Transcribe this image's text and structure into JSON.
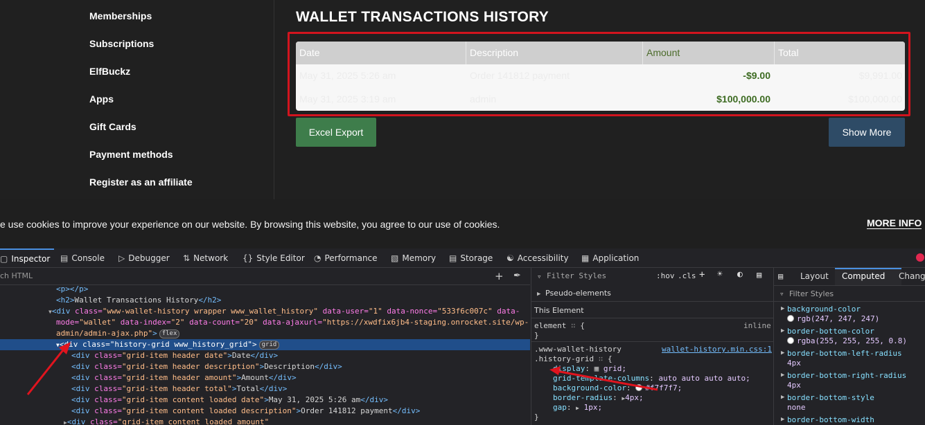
{
  "sidebar": {
    "items": [
      {
        "label": "Memberships"
      },
      {
        "label": "Subscriptions"
      },
      {
        "label": "ElfBuckz"
      },
      {
        "label": "Apps"
      },
      {
        "label": "Gift Cards"
      },
      {
        "label": "Payment methods"
      },
      {
        "label": "Register as an affiliate"
      }
    ]
  },
  "main": {
    "title": "WALLET TRANSACTIONS HISTORY",
    "table": {
      "columns": [
        "Date",
        "Description",
        "Amount",
        "Total"
      ],
      "rows": [
        {
          "date": "May 31, 2025 5:26 am",
          "description": "Order 141812 payment",
          "amount": "-$9.00",
          "total": "$9,991.00"
        },
        {
          "date": "May 31, 2025 3:19 am",
          "description": "admin",
          "amount": "$100,000.00",
          "total": "$100,000.00"
        }
      ]
    },
    "excel_label": "Excel Export",
    "show_more_label": "Show More",
    "highlight_color": "#d2141e"
  },
  "cookie": {
    "text": "e use cookies to improve your experience on our website. By browsing this website, you agree to our use of cookies.",
    "more_info": "MORE INFO"
  },
  "devtools": {
    "tabs": [
      {
        "label": "Inspector",
        "icon": "inspector-icon"
      },
      {
        "label": "Console",
        "icon": "console-icon"
      },
      {
        "label": "Debugger",
        "icon": "debugger-icon"
      },
      {
        "label": "Network",
        "icon": "network-icon"
      },
      {
        "label": "Style Editor",
        "icon": "style-editor-icon"
      },
      {
        "label": "Performance",
        "icon": "performance-icon"
      },
      {
        "label": "Memory",
        "icon": "memory-icon"
      },
      {
        "label": "Storage",
        "icon": "storage-icon"
      },
      {
        "label": "Accessibility",
        "icon": "accessibility-icon"
      },
      {
        "label": "Application",
        "icon": "application-icon"
      }
    ],
    "search_placeholder": "ch HTML",
    "html_lines": {
      "l1": "<p></p>",
      "l2_tag": "<h2>",
      "l2_text": "Wallet Transactions History",
      "l2_end": "</h2>",
      "l3a": "<div ",
      "l3_attr1": "class=",
      "l3_val1": "\"www-wallet-history wrapper www_wallet_history\"",
      "l3_attr2": " data-user=",
      "l3_val2": "\"1\"",
      "l3_attr3": " data-nonce=",
      "l3_val3": "\"533f6c007c\"",
      "l3_attr4": " data-",
      "l4_attr": "mode=",
      "l4_val": "\"wallet\"",
      "l4_attr2": " data-index=",
      "l4_val2": "\"2\"",
      "l4_attr3": " data-count=",
      "l4_val3": "\"20\"",
      "l4_attr4": " data-ajaxurl=",
      "l4_val4": "\"https://xwdfix6jb4-staging.onrocket.site/wp-",
      "l5_val": "admin/admin-ajax.php\"",
      "l5_end": ">",
      "flex_badge": "flex",
      "sel_tag": "<div ",
      "sel_attr": "class=",
      "sel_val": "\"history-grid www_history_grid\"",
      "sel_end": ">",
      "grid_badge": "grid",
      "child_lines": [
        {
          "cls": "\"grid-item header date\"",
          "text": "Date"
        },
        {
          "cls": "\"grid-item header description\"",
          "text": "Description"
        },
        {
          "cls": "\"grid-item header amount\"",
          "text": "Amount"
        },
        {
          "cls": "\"grid-item header total\"",
          "text": "Total"
        },
        {
          "cls": "\"grid-item content loaded date\"",
          "text": "May 31, 2025 5:26 am"
        },
        {
          "cls": "\"grid-item content loaded description\"",
          "text": "Order 141812 payment"
        },
        {
          "cls": "\"grid-item content loaded amount\"",
          "text": ""
        }
      ]
    },
    "rules": {
      "filter": "Filter Styles",
      "hov": ":hov",
      "cls": ".cls",
      "pseudo": "Pseudo-elements",
      "this_element": "This Element",
      "element_rule": "element",
      "inline": "inline",
      "selector1": ".www-wallet-history",
      "selector2": ".history-grid",
      "source": "wallet-history.min.css:1",
      "decls": [
        {
          "prop": "display",
          "val": "grid;"
        },
        {
          "prop": "grid-template-columns",
          "val": "auto auto auto auto;"
        },
        {
          "prop": "background-color",
          "val": "#f7f7f7;"
        },
        {
          "prop": "border-radius",
          "val": "4px;"
        },
        {
          "prop": "gap",
          "val": "1px;"
        }
      ]
    },
    "computed": {
      "tabs": [
        "Layout",
        "Computed",
        "Change"
      ],
      "filter": "Filter Styles",
      "items": [
        {
          "prop": "background-color",
          "val": "rgb(247, 247, 247)"
        },
        {
          "prop": "border-bottom-color",
          "val": "rgba(255, 255, 255, 0.8)"
        },
        {
          "prop": "border-bottom-left-radius",
          "val": "4px"
        },
        {
          "prop": "border-bottom-right-radius",
          "val": "4px"
        },
        {
          "prop": "border-bottom-style",
          "val": "none"
        },
        {
          "prop": "border-bottom-width",
          "val": ""
        }
      ]
    }
  }
}
